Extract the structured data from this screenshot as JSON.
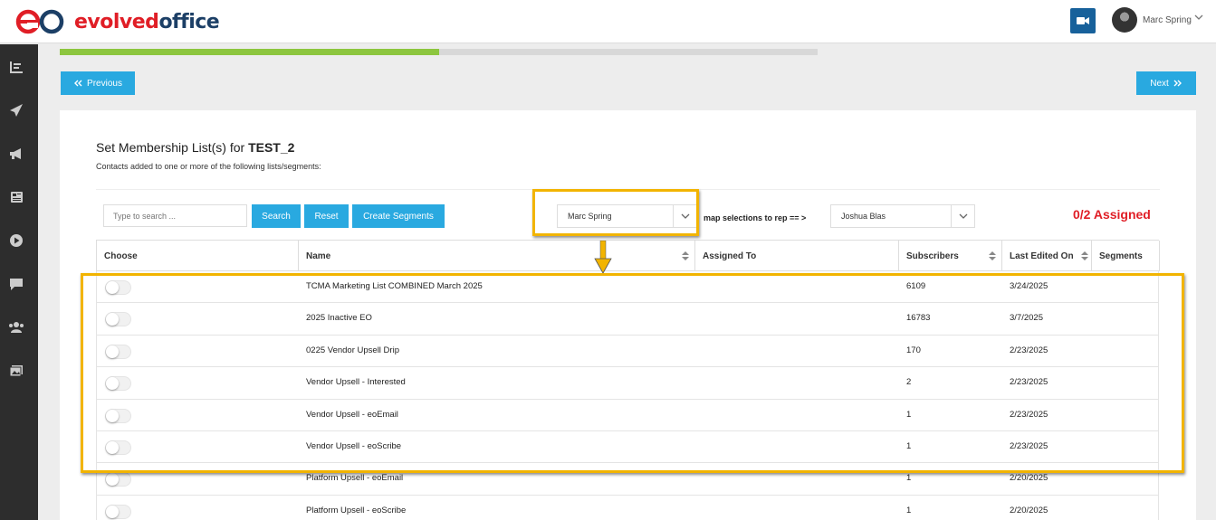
{
  "brand": {
    "name_part1": "evolved",
    "name_part2": "office"
  },
  "user": {
    "name": "Marc Spring"
  },
  "progress": {
    "percent": 50
  },
  "nav": {
    "previous_label": "Previous",
    "next_label": "Next"
  },
  "page": {
    "title_prefix": "Set Membership List(s) for ",
    "title_target": "TEST_2",
    "subtitle": "Contacts added to one or more of the following lists/segments:"
  },
  "toolbar": {
    "search_placeholder": "Type to search ...",
    "search_label": "Search",
    "reset_label": "Reset",
    "create_segments_label": "Create Segments",
    "owner_select_value": "Marc Spring",
    "map_label": "map selections to rep == >",
    "rep_select_value": "Joshua Blas",
    "assigned_status": "0/2 Assigned"
  },
  "table": {
    "columns": [
      "Choose",
      "Name",
      "Assigned To",
      "Subscribers",
      "Last Edited On",
      "Segments"
    ],
    "rows": [
      {
        "name": "TCMA Marketing List COMBINED March 2025",
        "assigned_to": "",
        "subscribers": "6109",
        "last_edited": "3/24/2025",
        "segments": ""
      },
      {
        "name": "2025 Inactive EO",
        "assigned_to": "",
        "subscribers": "16783",
        "last_edited": "3/7/2025",
        "segments": ""
      },
      {
        "name": "0225 Vendor Upsell Drip",
        "assigned_to": "",
        "subscribers": "170",
        "last_edited": "2/23/2025",
        "segments": ""
      },
      {
        "name": "Vendor Upsell - Interested",
        "assigned_to": "",
        "subscribers": "2",
        "last_edited": "2/23/2025",
        "segments": ""
      },
      {
        "name": "Vendor Upsell - eoEmail",
        "assigned_to": "",
        "subscribers": "1",
        "last_edited": "2/23/2025",
        "segments": ""
      },
      {
        "name": "Vendor Upsell - eoScribe",
        "assigned_to": "",
        "subscribers": "1",
        "last_edited": "2/23/2025",
        "segments": ""
      },
      {
        "name": "Platform Upsell - eoEmail",
        "assigned_to": "",
        "subscribers": "1",
        "last_edited": "2/20/2025",
        "segments": ""
      },
      {
        "name": "Platform Upsell - eoScribe",
        "assigned_to": "",
        "subscribers": "1",
        "last_edited": "2/20/2025",
        "segments": ""
      }
    ]
  },
  "sidebar": {
    "icons": [
      "reports-icon",
      "send-icon",
      "megaphone-icon",
      "newspaper-icon",
      "play-icon",
      "chat-icon",
      "users-icon",
      "images-icon"
    ]
  },
  "colors": {
    "accent": "#29a9e0",
    "brand_red": "#e01e26",
    "brand_navy": "#1c3f66",
    "progress_green": "#8dc63f",
    "highlight": "#f2b400",
    "sidebar": "#2d2d2d"
  }
}
